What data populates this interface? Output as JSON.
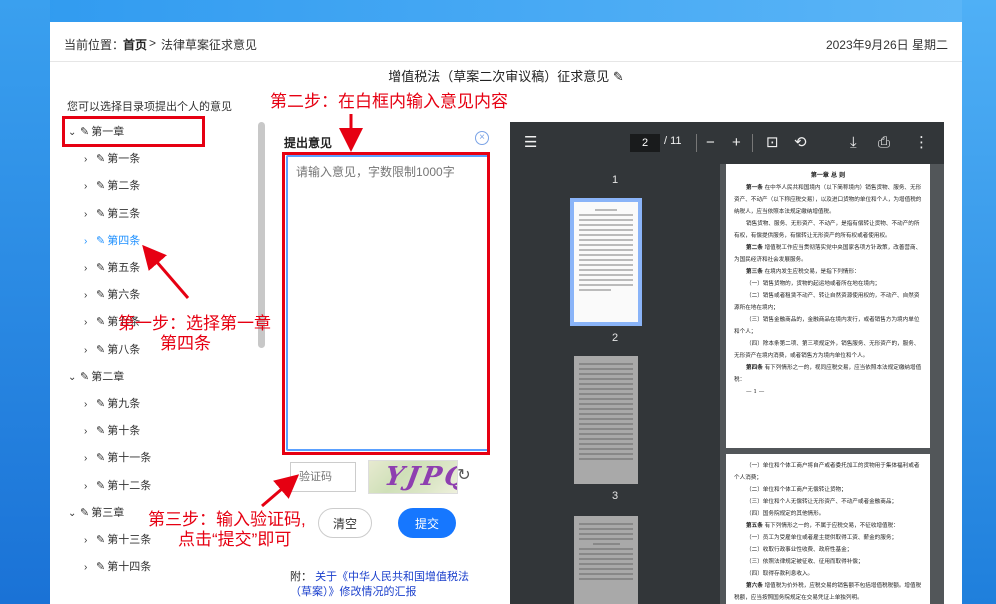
{
  "breadcrumb": {
    "label": "当前位置：",
    "home": "首页",
    "sep": ">",
    "current": "法律草案征求意见"
  },
  "date": "2023年9月26日 星期二",
  "doc_title": "增值税法（草案二次审议稿）征求意见",
  "hint": "您可以选择目录项提出个人的意见",
  "tree": [
    {
      "chev": "⌄",
      "label": "第一章"
    },
    {
      "chev": "›",
      "label": "第一条"
    },
    {
      "chev": "›",
      "label": "第二条"
    },
    {
      "chev": "›",
      "label": "第三条"
    },
    {
      "chev": "›",
      "label": "第四条"
    },
    {
      "chev": "›",
      "label": "第五条"
    },
    {
      "chev": "›",
      "label": "第六条"
    },
    {
      "chev": "›",
      "label": "第七条"
    },
    {
      "chev": "›",
      "label": "第八条"
    },
    {
      "chev": "⌄",
      "label": "第二章"
    },
    {
      "chev": "›",
      "label": "第九条"
    },
    {
      "chev": "›",
      "label": "第十条"
    },
    {
      "chev": "›",
      "label": "第十一条"
    },
    {
      "chev": "›",
      "label": "第十二条"
    },
    {
      "chev": "⌄",
      "label": "第三章"
    },
    {
      "chev": "›",
      "label": "第十三条"
    },
    {
      "chev": "›",
      "label": "第十四条"
    }
  ],
  "annotations": {
    "step1_line1": "第一步：选择第一章",
    "step1_line2": "第四条",
    "step2": "第二步：在白框内输入意见内容",
    "step3_line1": "第三步：输入验证码,",
    "step3_line2": "点击“提交”即可",
    "color": "#e60012"
  },
  "opinion": {
    "label": "提出意见",
    "placeholder": "请输入意见，字数限制1000字",
    "captcha_placeholder": "验证码",
    "captcha_code": "YJPQ",
    "clear": "清空",
    "submit": "提交",
    "attach_prefix": "附：",
    "attach_link": "关于《中华人民共和国增值税法（草案）》修改情况的汇报"
  },
  "viewer": {
    "page": "2",
    "total": "/ 11",
    "thumb_labels": [
      "1",
      "2",
      "3"
    ],
    "page1_heading": "第一章 总 则",
    "page1_paras": [
      {
        "head": "第一条",
        "text": "在中华人民共和国境内（以下简称境内）销售货物、服务、无形资产、不动产（以下称应税交易），以及进口货物的单位和个人，为增值税的纳税人，应当依照本法规定缴纳增值税。"
      },
      {
        "head": "",
        "text": "销售货物、服务、无形资产、不动产，是指有偿转让货物、不动产的所有权，有偿提供服务，有偿转让无形资产的所有权或者使用权。"
      },
      {
        "head": "第二条",
        "text": "增值税工作应当贯彻落实党中央国家各项方针政策，改善营商、为国民经济和社会发展服务。"
      },
      {
        "head": "第三条",
        "text": "在境内发生应税交易，是指下列情形："
      },
      {
        "head": "",
        "text": "（一）销售货物的，货物的起运地或者所在地在境内；"
      },
      {
        "head": "",
        "text": "（二）销售或者租赁不动产、转让自然资源使用权的，不动产、自然资源所在地在境内；"
      },
      {
        "head": "",
        "text": "（三）销售金融商品的，金融商品在境内发行，或者销售方为境内单位和个人；"
      },
      {
        "head": "",
        "text": "（四）除本条第二项、第三项规定外，销售服务、无形资产的，服务、无形资产在境内消费，或者销售方为境内单位和个人。"
      },
      {
        "head": "第四条",
        "text": "有下列情形之一的，视同应税交易，应当依照本法规定缴纳增值税："
      },
      {
        "head": "",
        "text": "— 1 —"
      }
    ],
    "page2_paras": [
      {
        "head": "",
        "text": "（一）单位和个体工商户将自产或者委托加工的货物用于集体福利或者个人消费；"
      },
      {
        "head": "",
        "text": "（二）单位和个体工商户无偿转让货物；"
      },
      {
        "head": "",
        "text": "（三）单位和个人无偿转让无形资产、不动产或者金融商品；"
      },
      {
        "head": "",
        "text": "（四）国务院规定的其他情形。"
      },
      {
        "head": "第五条",
        "text": "有下列情形之一的，不属于应税交易，不征收增值税："
      },
      {
        "head": "",
        "text": "（一）员工为受雇单位或者雇主提供取得工资、薪金的服务；"
      },
      {
        "head": "",
        "text": "（二）收取行政事业性收费、政府性基金；"
      },
      {
        "head": "",
        "text": "（三）依照法律规定被征收、征用而取得补偿；"
      },
      {
        "head": "",
        "text": "（四）取得存款利息收入。"
      },
      {
        "head": "第六条",
        "text": "增值税为价外税，应税交易的销售额不包括增值税税额。增值税税额，应当按照国务院规定在交易凭证上单独列明。"
      }
    ]
  }
}
